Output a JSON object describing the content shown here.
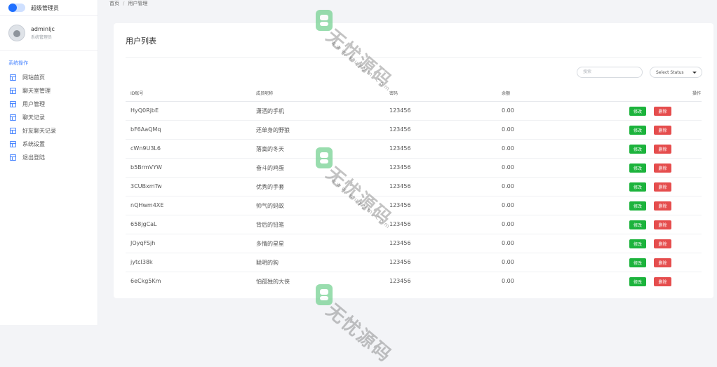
{
  "app": {
    "brand_title": "超级管理员"
  },
  "user": {
    "name": "adminljc",
    "role": "系统管理员"
  },
  "sidebar": {
    "section_title": "系统操作",
    "items": [
      {
        "label": "网站首页"
      },
      {
        "label": "聊天室管理"
      },
      {
        "label": "用户管理"
      },
      {
        "label": "聊天记录"
      },
      {
        "label": "好友聊天记录"
      },
      {
        "label": "系统设置"
      },
      {
        "label": "退出登陆"
      }
    ]
  },
  "breadcrumb": {
    "home": "首页",
    "separator": "/",
    "current": "用户管理"
  },
  "card": {
    "title": "用户列表"
  },
  "filters": {
    "search_placeholder": "搜索",
    "status_select": "Select Status"
  },
  "table": {
    "headers": [
      "ID账号",
      "成员昵称",
      "密码",
      "余额",
      "操作"
    ],
    "edit_label": "修改",
    "delete_label": "删除",
    "rows": [
      {
        "id": "HyQ0RjbE",
        "nickname": "潇洒的手机",
        "password": "123456",
        "balance": "0.00"
      },
      {
        "id": "bF6AaQMq",
        "nickname": "还单身的野狼",
        "password": "123456",
        "balance": "0.00"
      },
      {
        "id": "cWn9U3L6",
        "nickname": "落寞的冬天",
        "password": "123456",
        "balance": "0.00"
      },
      {
        "id": "b5BrmVYW",
        "nickname": "奋斗的鸡蛋",
        "password": "123456",
        "balance": "0.00"
      },
      {
        "id": "3CUBxmTw",
        "nickname": "优秀的手套",
        "password": "123456",
        "balance": "0.00"
      },
      {
        "id": "nQHwm4XE",
        "nickname": "帅气的蚂蚁",
        "password": "123456",
        "balance": "0.00"
      },
      {
        "id": "658jgCaL",
        "nickname": "背后的铅笔",
        "password": "123456",
        "balance": "0.00"
      },
      {
        "id": "JOyqFSjh",
        "nickname": "多情的星星",
        "password": "123456",
        "balance": "0.00"
      },
      {
        "id": "jytcI38k",
        "nickname": "聪明的狗",
        "password": "123456",
        "balance": "0.00"
      },
      {
        "id": "6eCkg5Km",
        "nickname": "怕孤独的大侠",
        "password": "123456",
        "balance": "0.00"
      }
    ]
  },
  "watermark": {
    "text": "无忧源码",
    "url": "www.wuyym.com"
  },
  "colors": {
    "accent": "#4a86ff",
    "edit_button": "#1cb33c",
    "delete_button": "#e54d4d"
  }
}
